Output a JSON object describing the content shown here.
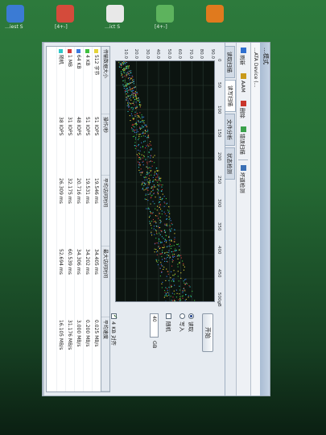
{
  "desktop": {
    "icons": [
      {
        "name": "app-icon-1",
        "label": "…iest S",
        "color": "#3b7bd4"
      },
      {
        "name": "app-icon-2",
        "label": "[4+-]",
        "color": "#d44b3b"
      },
      {
        "name": "app-icon-3",
        "label": "…ict S",
        "color": "#e8e8e8"
      },
      {
        "name": "app-icon-4",
        "label": "[4+-]",
        "color": "#5db35d"
      },
      {
        "name": "app-icon-5",
        "label": "",
        "color": "#e07a1e"
      }
    ]
  },
  "window": {
    "title": "…模式",
    "path": "…ATA Device (…",
    "toolbar": [
      {
        "label": "刷新",
        "icon": "refresh-icon",
        "color": "#2f6fcf"
      },
      {
        "label": "AAM",
        "icon": "aam-icon",
        "color": "#c99a1b"
      },
      {
        "label": "删除",
        "icon": "delete-icon",
        "color": "#c9352b"
      },
      {
        "label": "错误扫描",
        "icon": "scan-icon",
        "color": "#3aa14b"
      },
      {
        "label": "",
        "icon": "sep",
        "color": ""
      },
      {
        "label": "坏道检测",
        "icon": "disk-icon",
        "color": "#3a6fb5"
      }
    ],
    "tabs": [
      {
        "label": "读取扫描",
        "active": false
      },
      {
        "label": "读写扫描",
        "active": true
      },
      {
        "label": "文件分析",
        "active": false
      },
      {
        "label": "状态检测",
        "active": false
      }
    ]
  },
  "plot": {
    "y_ticks": [
      "90.0",
      "80.0",
      "70.0",
      "60.0",
      "50.0",
      "40.0",
      "30.0",
      "20.0",
      "10.0"
    ],
    "x_ticks": [
      "0",
      "50",
      "100",
      "150",
      "200",
      "250",
      "300",
      "350",
      "400",
      "450",
      "500gB"
    ]
  },
  "side": {
    "start_label": "开始",
    "radio_read": "读取",
    "radio_write": "写入",
    "check_align": "4 KB 对齐",
    "spin_value": "40",
    "unit": "GB",
    "check_random": "随机"
  },
  "table": {
    "headers": [
      "传输数据大小",
      "操作/秒",
      "平均访问时间",
      "最大访问时间",
      "平均速度"
    ],
    "rows": [
      {
        "color": "#e5d43a",
        "size": "512 字节",
        "ops": "51 IOPS",
        "avg": "19.546 ms",
        "max": "34.405 ms",
        "speed": "0.025 MB/s"
      },
      {
        "color": "#3fbf3f",
        "size": "4 KB",
        "ops": "51 IOPS",
        "avg": "19.531 ms",
        "max": "34.202 ms",
        "speed": "0.200 MB/s"
      },
      {
        "color": "#3b7ae0",
        "size": "64 KB",
        "ops": "48 IOPS",
        "avg": "20.716 ms",
        "max": "34.306 ms",
        "speed": "3.000 MB/s"
      },
      {
        "color": "#d33a3a",
        "size": "1 MB",
        "ops": "31 IOPS",
        "avg": "32.175 ms",
        "max": "60.539 ms",
        "speed": "31.176 MB/s"
      },
      {
        "color": "#2fc7c7",
        "size": "随机",
        "ops": "38 IOPS",
        "avg": "26.309 ms",
        "max": "52.694 ms",
        "speed": "16.105 MB/s"
      }
    ]
  }
}
